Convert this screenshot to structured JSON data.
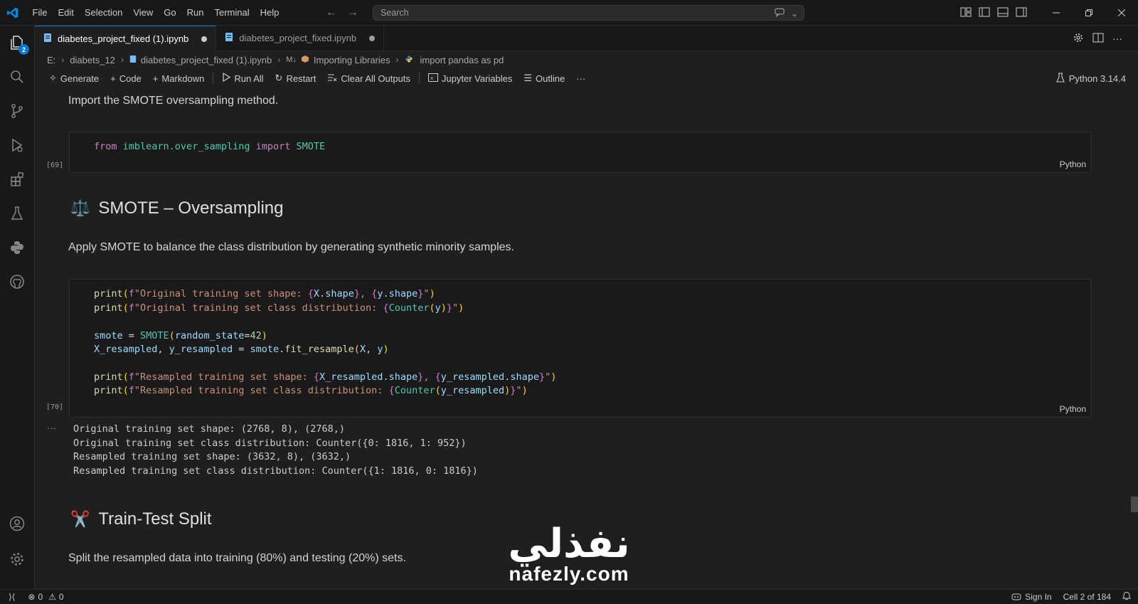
{
  "menu": [
    "File",
    "Edit",
    "Selection",
    "View",
    "Go",
    "Run",
    "Terminal",
    "Help"
  ],
  "search": {
    "placeholder": "Search"
  },
  "activity": {
    "explorer_badge": "2"
  },
  "tabs": [
    {
      "label": "diabetes_project_fixed (1).ipynb"
    },
    {
      "label": "diabetes_project_fixed.ipynb"
    }
  ],
  "breadcrumb": {
    "drive": "E:",
    "folder": "diabets_12",
    "file": "diabetes_project_fixed (1).ipynb",
    "md_marker": "M↓",
    "section": "Importing Libraries",
    "symbol": "import pandas as pd"
  },
  "toolbar": {
    "generate": "Generate",
    "code": "Code",
    "markdown": "Markdown",
    "run_all": "Run All",
    "restart": "Restart",
    "clear_outputs": "Clear All Outputs",
    "variables": "Jupyter Variables",
    "outline": "Outline",
    "more": "···",
    "kernel": "Python 3.14.4"
  },
  "cells": {
    "md1": "Import the SMOTE oversampling method.",
    "code1": {
      "count": "[69]",
      "lang": "Python",
      "line1": {
        "kw1": "from",
        "mod": "imblearn.over_sampling",
        "kw2": "import",
        "name": "SMOTE"
      }
    },
    "heading1": {
      "emoji": "⚖️",
      "text": "SMOTE – Oversampling"
    },
    "md2": "Apply SMOTE to balance the class distribution by generating synthetic minority samples.",
    "code2": {
      "count": "[70]",
      "lang": "Python",
      "lines": [
        "print(f\"Original training set shape: {X.shape}, {y.shape}\")",
        "print(f\"Original training set class distribution: {Counter(y)}\")",
        "smote = SMOTE(random_state=42)",
        "X_resampled, y_resampled = smote.fit_resample(X, y)",
        "print(f\"Resampled training set shape: {X_resampled.shape}, {y_resampled.shape}\")",
        "print(f\"Resampled training set class distribution: {Counter(y_resampled)}\")"
      ]
    },
    "output2": {
      "dots": "···",
      "lines": [
        "Original training set shape: (2768, 8), (2768,)",
        "Original training set class distribution: Counter({0: 1816, 1: 952})",
        "Resampled training set shape: (3632, 8), (3632,)",
        "Resampled training set class distribution: Counter({1: 1816, 0: 1816})"
      ]
    },
    "heading2": {
      "emoji": "✂️",
      "text": "Train-Test Split"
    },
    "md3": "Split the resampled data into training (80%) and testing (20%) sets."
  },
  "watermark": {
    "arabic": "نفذلي",
    "latin": "nafezly.com"
  },
  "statusbar": {
    "errors": "0",
    "warnings": "0",
    "signin": "Sign In",
    "cell": "Cell 2 of 184"
  },
  "colors": {
    "accent": "#0078d4",
    "background": "#1f1f1f",
    "chrome": "#181818"
  }
}
